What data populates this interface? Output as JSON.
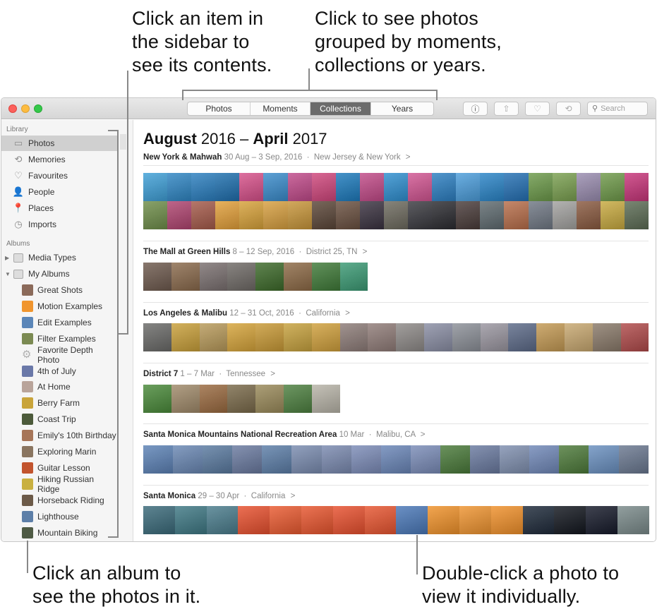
{
  "callouts": {
    "sidebar": [
      "Click an item in",
      "the sidebar to",
      "see its contents."
    ],
    "grouping": [
      "Click to see photos",
      "grouped by moments,",
      "collections or years."
    ],
    "album": [
      "Click an album to",
      "see the photos in it."
    ],
    "photo": [
      "Double-click a photo to",
      "view it individually."
    ]
  },
  "toolbar": {
    "segments": [
      {
        "label": "Photos",
        "active": false
      },
      {
        "label": "Moments",
        "active": false
      },
      {
        "label": "Collections",
        "active": true
      },
      {
        "label": "Years",
        "active": false
      }
    ],
    "info_icon": "ⓘ",
    "share_icon": "⇧",
    "heart_icon": "♡",
    "rotate_icon": "⟲",
    "search_icon": "⚲",
    "search_placeholder": "Search"
  },
  "sidebar": {
    "library_header": "Library",
    "library_items": [
      {
        "label": "Photos",
        "icon": "▭",
        "selected": true
      },
      {
        "label": "Memories",
        "icon": "⟲"
      },
      {
        "label": "Favourites",
        "icon": "♡"
      },
      {
        "label": "People",
        "icon": "👤"
      },
      {
        "label": "Places",
        "icon": "📍"
      },
      {
        "label": "Imports",
        "icon": "◷"
      }
    ],
    "albums_header": "Albums",
    "album_groups": [
      {
        "label": "Media Types",
        "expanded": false,
        "triangle": "▶"
      },
      {
        "label": "My Albums",
        "expanded": true,
        "triangle": "▼"
      }
    ],
    "albums": [
      {
        "label": "Great Shots",
        "thumb": "#8b6a5a"
      },
      {
        "label": "Motion Examples",
        "thumb": "#f0952e"
      },
      {
        "label": "Edit Examples",
        "thumb": "#5b86b8"
      },
      {
        "label": "Filter Examples",
        "thumb": "#7b8a52"
      },
      {
        "label": "Favorite Depth Photo",
        "thumb": "gear"
      },
      {
        "label": "4th of July",
        "thumb": "#6a78a8"
      },
      {
        "label": "At Home",
        "thumb": "#b9a49a"
      },
      {
        "label": "Berry Farm",
        "thumb": "#c9a43a"
      },
      {
        "label": "Coast Trip",
        "thumb": "#4c5a3a"
      },
      {
        "label": "Emily's 10th Birthday",
        "thumb": "#a67558"
      },
      {
        "label": "Exploring Marin",
        "thumb": "#8a7560"
      },
      {
        "label": "Guitar Lesson",
        "thumb": "#c2542e"
      },
      {
        "label": "Hiking Russian Ridge",
        "thumb": "#c9b040"
      },
      {
        "label": "Horseback Riding",
        "thumb": "#6c5a48"
      },
      {
        "label": "Lighthouse",
        "thumb": "#5d7fa8"
      },
      {
        "label": "Mountain Biking",
        "thumb": "#4e5a44"
      }
    ]
  },
  "main": {
    "title_month1": "August",
    "title_year1": "2016",
    "title_sep": "–",
    "title_month2": "April",
    "title_year2": "2017",
    "collections": [
      {
        "name": "New York & Mahwah",
        "dates": "30 Aug – 3 Sep, 2016",
        "location": "New Jersey & New York",
        "chevron": ">",
        "photos": [
          "#3fa0d8",
          "#2f86c4",
          "#2b7fc0",
          "#1e6fae",
          "#d7508a",
          "#3a8ccc",
          "#c14a8a",
          "#d0467c",
          "#1d7bbd",
          "#c24a88",
          "#2f8fd0",
          "#d25592",
          "#2c7fc2",
          "#4c9edc",
          "#2a85c8",
          "#2470b4",
          "#6c9a4a",
          "#7aa050",
          "#9a8db0",
          "#6f9a4a",
          "#c8357a",
          "#6f8e4a",
          "#b04470",
          "#a55a4a",
          "#e3a03a",
          "#d8a23a",
          "#d8a040",
          "#c8963a",
          "#5b4638",
          "#6a5040",
          "#3a3240",
          "#6d6a5e",
          "#3a3a40",
          "#2b2b30",
          "#4a3c3a",
          "#5f6b70",
          "#b86e4a",
          "#707884",
          "#a3a2a0",
          "#8a5a40",
          "#c8aa40",
          "#5c6c54"
        ]
      },
      {
        "name": "The Mall at Green Hills",
        "dates": "8 – 12 Sep, 2016",
        "location": "District 25, TN",
        "chevron": ">",
        "photos": [
          "#6e5a4e",
          "#8a6a4c",
          "#7a7070",
          "#6f6a66",
          "#3d6a2a",
          "#8d6a46",
          "#3f7a38",
          "#3b9a74"
        ]
      },
      {
        "name": "Los Angeles & Malibu",
        "dates": "12 – 31 Oct, 2016",
        "location": "California",
        "chevron": ">",
        "photos": [
          "#6a6a68",
          "#c9a03a",
          "#b89a5a",
          "#d6a43a",
          "#c99a36",
          "#c7a23e",
          "#d0a03c",
          "#8d7c78",
          "#907c78",
          "#8e8a88",
          "#8a8ea4",
          "#8c9098",
          "#9a96a0",
          "#5c6a88",
          "#c49a54",
          "#c8a870",
          "#8a7a6a",
          "#b04a4a"
        ]
      },
      {
        "name": "District 7",
        "dates": "1 – 7 Mar",
        "location": "Tennessee",
        "chevron": ">",
        "photos": [
          "#4a8a3a",
          "#a08a6a",
          "#9a6a40",
          "#7a6a4a",
          "#9a8a5a",
          "#4d8040",
          "#b8b4a8"
        ]
      },
      {
        "name": "Santa Monica Mountains National Recreation Area",
        "dates": "10 Mar",
        "location": "Malibu, CA",
        "chevron": ">",
        "photos": [
          "#5c82b6",
          "#6a88b4",
          "#5a7aa0",
          "#6a7aa0",
          "#5c7ea8",
          "#7a8cb0",
          "#7a8ab0",
          "#7c8cb8",
          "#6a86b8",
          "#7a8cb8",
          "#4a7a3a",
          "#6a7aa0",
          "#8090b0",
          "#7088b8",
          "#4d7a3a",
          "#6a90c0",
          "#6a7890"
        ]
      },
      {
        "name": "Santa Monica",
        "dates": "29 – 30 Apr",
        "location": "California",
        "chevron": ">",
        "photos": [
          "#3a6a7a",
          "#3e7884",
          "#4a7c8c",
          "#e8502e",
          "#ea5a30",
          "#e8552e",
          "#e8502e",
          "#e85530",
          "#4a78b8",
          "#f0922a",
          "#ef9430",
          "#f0902a",
          "#1e2a3a",
          "#12161e",
          "#161a2a",
          "#7a8a8a"
        ]
      }
    ]
  }
}
